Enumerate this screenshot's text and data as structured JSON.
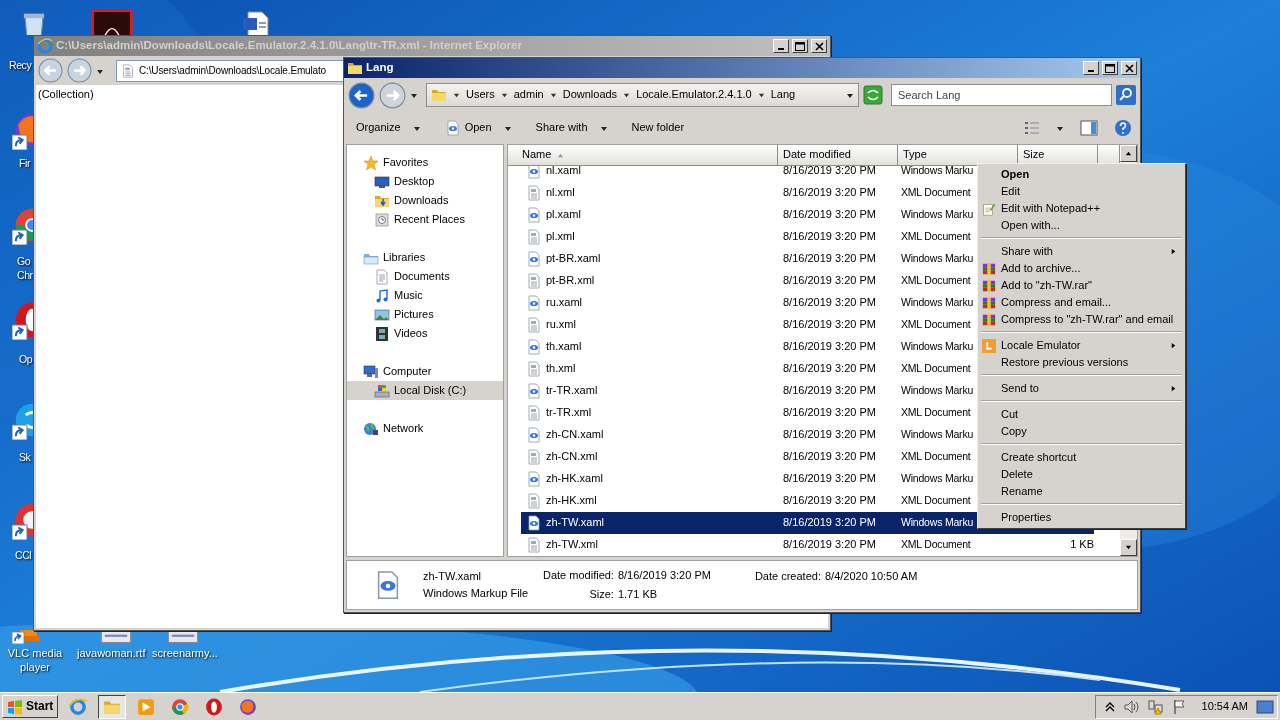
{
  "desktop_icons": [
    {
      "kind": "recycle",
      "shortcut": false,
      "lines": [
        "Recy"
      ]
    },
    {
      "kind": "pdf"
    },
    {
      "kind": "word",
      "shortcut": false
    },
    {
      "kind": "firefox",
      "shortcut": true,
      "lines": [
        "Fir"
      ]
    },
    {
      "kind": "chrome",
      "shortcut": true,
      "lines": [
        "Go",
        "Chr"
      ]
    },
    {
      "kind": "opera",
      "shortcut": true,
      "lines": [
        "Op"
      ]
    },
    {
      "kind": "skype",
      "shortcut": true,
      "lines": [
        "Sk"
      ]
    },
    {
      "kind": "ccleaner",
      "shortcut": true,
      "lines": [
        "CCl"
      ]
    },
    {
      "kind": "vlc",
      "shortcut": true,
      "lines": [
        "VLC media",
        "player"
      ]
    },
    {
      "kind": "rtf",
      "shortcut": false,
      "lines": [
        "javawoman.rtf"
      ]
    },
    {
      "kind": "document",
      "shortcut": false,
      "lines": [
        "screenarmy..."
      ]
    }
  ],
  "ie_window": {
    "title": "C:\\Users\\admin\\Downloads\\Locale.Emulator.2.4.1.0\\Lang\\tr-TR.xml - Internet Explorer",
    "active": false,
    "address": "C:\\Users\\admin\\Downloads\\Locale.Emulato",
    "content": "(Collection)"
  },
  "explorer": {
    "title": "Lang",
    "active": true,
    "breadcrumb": [
      "Users",
      "admin",
      "Downloads",
      "Locale.Emulator.2.4.1.0",
      "Lang"
    ],
    "search": {
      "placeholder": "Search Lang"
    },
    "toolbar": [
      {
        "label": "Organize",
        "kind": "menu"
      },
      {
        "label": "Open",
        "kind": "open"
      },
      {
        "label": "Share with",
        "kind": "menu"
      },
      {
        "label": "New folder",
        "kind": "plain"
      }
    ],
    "nav": [
      {
        "label": "Favorites",
        "kind": "star",
        "selected": false,
        "children": [
          {
            "label": "Desktop",
            "kind": "desktop",
            "selected": false
          },
          {
            "label": "Downloads",
            "kind": "downloads",
            "selected": false
          },
          {
            "label": "Recent Places",
            "kind": "recent",
            "selected": false
          }
        ]
      },
      {
        "label": "Libraries",
        "kind": "libraries",
        "selected": false,
        "children": [
          {
            "label": "Documents",
            "kind": "documents",
            "selected": false
          },
          {
            "label": "Music",
            "kind": "music",
            "selected": false
          },
          {
            "label": "Pictures",
            "kind": "pictures",
            "selected": false
          },
          {
            "label": "Videos",
            "kind": "videos",
            "selected": false
          }
        ]
      },
      {
        "label": "Computer",
        "kind": "computer",
        "selected": false,
        "children": [
          {
            "label": "Local Disk (C:)",
            "kind": "disk",
            "selected": true
          }
        ]
      },
      {
        "label": "Network",
        "kind": "network",
        "selected": false
      }
    ],
    "columns": [
      {
        "label": "Name",
        "sorted": true
      },
      {
        "label": "Date modified",
        "sorted": false
      },
      {
        "label": "Type",
        "sorted": false
      },
      {
        "label": "Size",
        "sorted": false
      }
    ],
    "files": [
      {
        "name": "nl.xaml",
        "kind": "xaml",
        "date": "8/16/2019 3:20 PM",
        "type": "Windows Marku",
        "selected": false
      },
      {
        "name": "nl.xml",
        "kind": "xml",
        "date": "8/16/2019 3:20 PM",
        "type": "XML Document",
        "selected": false
      },
      {
        "name": "pl.xaml",
        "kind": "xaml",
        "date": "8/16/2019 3:20 PM",
        "type": "Windows Marku",
        "selected": false
      },
      {
        "name": "pl.xml",
        "kind": "xml",
        "date": "8/16/2019 3:20 PM",
        "type": "XML Document",
        "selected": false
      },
      {
        "name": "pt-BR.xaml",
        "kind": "xaml",
        "date": "8/16/2019 3:20 PM",
        "type": "Windows Marku",
        "selected": false
      },
      {
        "name": "pt-BR.xml",
        "kind": "xml",
        "date": "8/16/2019 3:20 PM",
        "type": "XML Document",
        "selected": false
      },
      {
        "name": "ru.xaml",
        "kind": "xaml",
        "date": "8/16/2019 3:20 PM",
        "type": "Windows Marku",
        "selected": false
      },
      {
        "name": "ru.xml",
        "kind": "xml",
        "date": "8/16/2019 3:20 PM",
        "type": "XML Document",
        "selected": false
      },
      {
        "name": "th.xaml",
        "kind": "xaml",
        "date": "8/16/2019 3:20 PM",
        "type": "Windows Marku",
        "selected": false
      },
      {
        "name": "th.xml",
        "kind": "xml",
        "date": "8/16/2019 3:20 PM",
        "type": "XML Document",
        "selected": false
      },
      {
        "name": "tr-TR.xaml",
        "kind": "xaml",
        "date": "8/16/2019 3:20 PM",
        "type": "Windows Marku",
        "selected": false
      },
      {
        "name": "tr-TR.xml",
        "kind": "xml",
        "date": "8/16/2019 3:20 PM",
        "type": "XML Document",
        "selected": false
      },
      {
        "name": "zh-CN.xaml",
        "kind": "xaml",
        "date": "8/16/2019 3:20 PM",
        "type": "Windows Marku",
        "selected": false
      },
      {
        "name": "zh-CN.xml",
        "kind": "xml",
        "date": "8/16/2019 3:20 PM",
        "type": "XML Document",
        "selected": false
      },
      {
        "name": "zh-HK.xaml",
        "kind": "xaml",
        "date": "8/16/2019 3:20 PM",
        "type": "Windows Marku",
        "selected": false
      },
      {
        "name": "zh-HK.xml",
        "kind": "xml",
        "date": "8/16/2019 3:20 PM",
        "type": "XML Document",
        "selected": false
      },
      {
        "name": "zh-TW.xaml",
        "kind": "xaml",
        "date": "8/16/2019 3:20 PM",
        "type": "Windows Marku",
        "selected": true
      },
      {
        "name": "zh-TW.xml",
        "kind": "xml",
        "date": "8/16/2019 3:20 PM",
        "type": "XML Document",
        "size": "1 KB",
        "selected": false
      }
    ],
    "details": {
      "kind": "xaml",
      "name": "zh-TW.xaml",
      "type": "Windows Markup File",
      "fields": [
        {
          "label": "Date modified:",
          "value": "8/16/2019 3:20 PM"
        },
        {
          "label": "Size:",
          "value": "1.71 KB"
        },
        {
          "label": "Date created:",
          "value": "8/4/2020 10:50 AM"
        }
      ]
    }
  },
  "context_menu": {
    "items": [
      {
        "kind": "plain",
        "label": "Open",
        "default": true,
        "submenu": false
      },
      {
        "kind": "plain",
        "label": "Edit",
        "default": false,
        "submenu": false
      },
      {
        "kind": "notepad",
        "label": "Edit with Notepad++",
        "default": false,
        "submenu": false
      },
      {
        "kind": "plain",
        "label": "Open with...",
        "default": false,
        "submenu": false
      },
      {
        "kind": "separator"
      },
      {
        "kind": "plain",
        "label": "Share with",
        "default": false,
        "submenu": true
      },
      {
        "kind": "archive",
        "label": "Add to archive...",
        "default": false,
        "submenu": false
      },
      {
        "kind": "archive",
        "label": "Add to \"zh-TW.rar\"",
        "default": false,
        "submenu": false
      },
      {
        "kind": "archive",
        "label": "Compress and email...",
        "default": false,
        "submenu": false
      },
      {
        "kind": "archive",
        "label": "Compress to \"zh-TW.rar\" and email",
        "default": false,
        "submenu": false
      },
      {
        "kind": "separator"
      },
      {
        "kind": "emulator",
        "label": "Locale Emulator",
        "default": false,
        "submenu": true
      },
      {
        "kind": "plain",
        "label": "Restore previous versions",
        "default": false,
        "submenu": false
      },
      {
        "kind": "separator"
      },
      {
        "kind": "plain",
        "label": "Send to",
        "default": false,
        "submenu": true
      },
      {
        "kind": "separator"
      },
      {
        "kind": "plain",
        "label": "Cut",
        "default": false,
        "submenu": false
      },
      {
        "kind": "plain",
        "label": "Copy",
        "default": false,
        "submenu": false
      },
      {
        "kind": "separator"
      },
      {
        "kind": "plain",
        "label": "Create shortcut",
        "default": false,
        "submenu": false
      },
      {
        "kind": "plain",
        "label": "Delete",
        "default": false,
        "submenu": false
      },
      {
        "kind": "plain",
        "label": "Rename",
        "default": false,
        "submenu": false
      },
      {
        "kind": "separator"
      },
      {
        "kind": "plain",
        "label": "Properties",
        "default": false,
        "submenu": false
      }
    ]
  },
  "taskbar": {
    "start": "Start",
    "apps": [
      {
        "kind": "ie",
        "active": false
      },
      {
        "kind": "explorer",
        "active": true
      },
      {
        "kind": "media",
        "active": false
      },
      {
        "kind": "chrome",
        "active": false
      },
      {
        "kind": "opera",
        "active": false
      },
      {
        "kind": "firefox",
        "active": false
      }
    ],
    "clock": "10:54 AM"
  }
}
